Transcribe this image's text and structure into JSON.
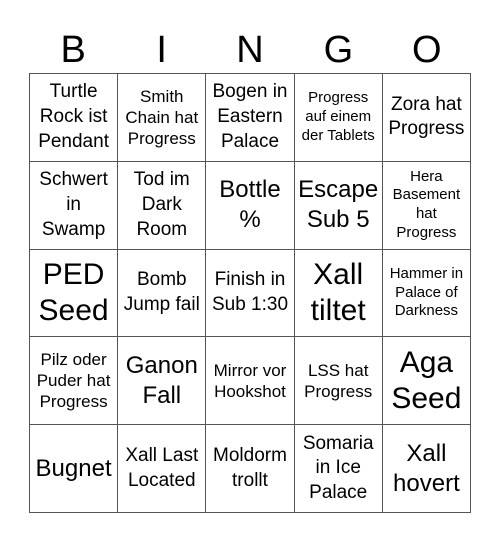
{
  "header": {
    "letters": [
      "B",
      "I",
      "N",
      "G",
      "O"
    ]
  },
  "cells": [
    [
      "Turtle Rock ist Pendant",
      "Smith Chain hat Progress",
      "Bogen in Eastern Palace",
      "Progress auf einem der Tablets",
      "Zora hat Progress"
    ],
    [
      "Schwert in Swamp",
      "Tod im Dark Room",
      "Bottle %",
      "Escape Sub 5",
      "Hera Basement hat Progress"
    ],
    [
      "PED Seed",
      "Bomb Jump fail",
      "Finish in Sub 1:30",
      "Xall tiltet",
      "Hammer in Palace of Darkness"
    ],
    [
      "Pilz oder Puder hat Progress",
      "Ganon Fall",
      "Mirror vor Hookshot",
      "LSS hat Progress",
      "Aga Seed"
    ],
    [
      "Bugnet",
      "Xall Last Located",
      "Moldorm trollt",
      "Somaria in Ice Palace",
      "Xall hovert"
    ]
  ]
}
